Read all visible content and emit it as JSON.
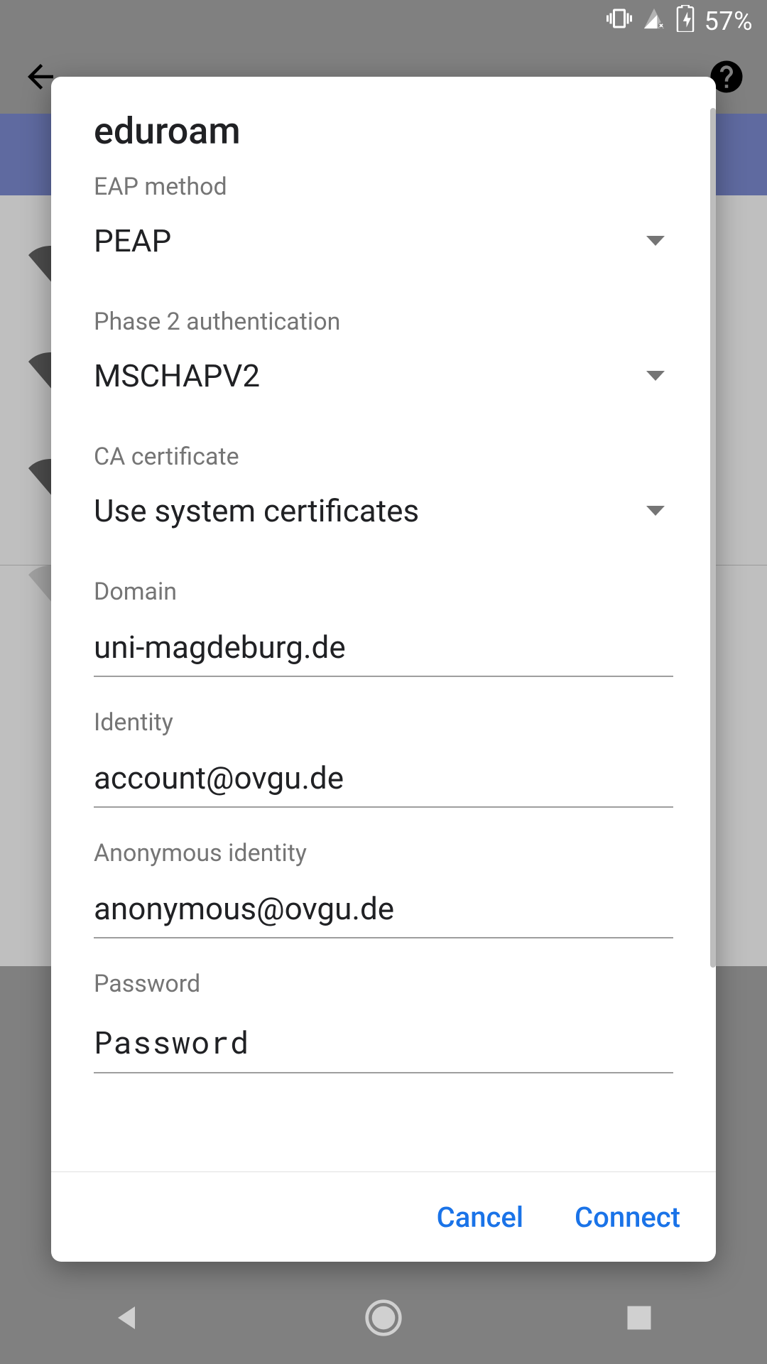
{
  "statusbar": {
    "battery_text": "57%"
  },
  "dialog": {
    "title": "eduroam",
    "fields": {
      "eap": {
        "label": "EAP method",
        "value": "PEAP"
      },
      "phase2": {
        "label": "Phase 2 authentication",
        "value": "MSCHAPV2"
      },
      "ca": {
        "label": "CA certificate",
        "value": "Use system certificates"
      },
      "domain": {
        "label": "Domain",
        "value": "uni-magdeburg.de"
      },
      "identity": {
        "label": "Identity",
        "value": "account@ovgu.de"
      },
      "anonymous": {
        "label": "Anonymous identity",
        "value": "anonymous@ovgu.de"
      },
      "password": {
        "label": "Password",
        "value": "Password"
      }
    },
    "buttons": {
      "cancel": "Cancel",
      "connect": "Connect"
    }
  }
}
